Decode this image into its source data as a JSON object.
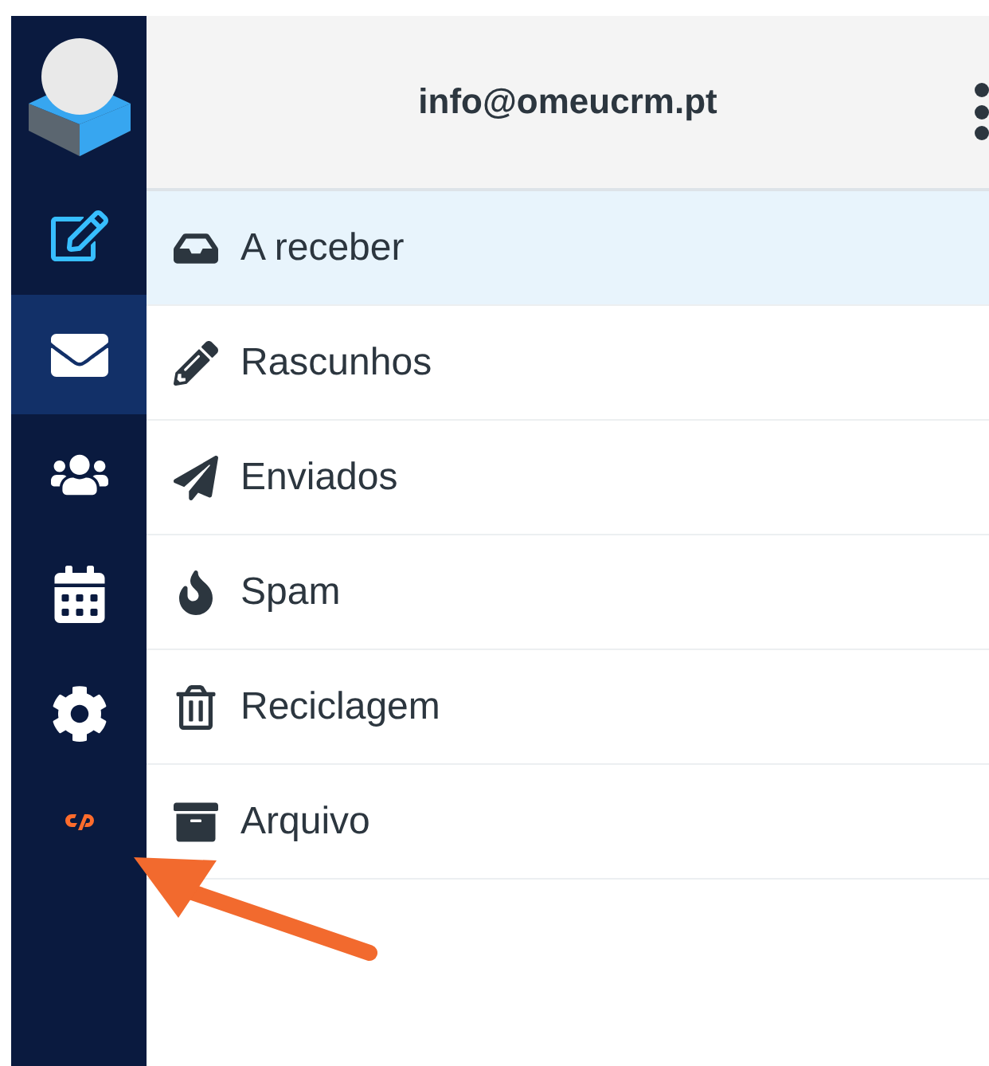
{
  "sidebar": {
    "items": [
      {
        "kind": "compose",
        "selected": false
      },
      {
        "kind": "mail",
        "selected": true
      },
      {
        "kind": "contacts",
        "selected": false
      },
      {
        "kind": "calendar",
        "selected": false
      },
      {
        "kind": "settings",
        "selected": false
      },
      {
        "kind": "cpanel",
        "selected": false
      }
    ]
  },
  "header": {
    "title": "info@omeucrm.pt"
  },
  "folders": [
    {
      "kind": "inbox",
      "label": "A receber",
      "selected": true
    },
    {
      "kind": "drafts",
      "label": "Rascunhos",
      "selected": false
    },
    {
      "kind": "sent",
      "label": "Enviados",
      "selected": false
    },
    {
      "kind": "spam",
      "label": "Spam",
      "selected": false
    },
    {
      "kind": "trash",
      "label": "Reciclagem",
      "selected": false
    },
    {
      "kind": "archive",
      "label": "Arquivo",
      "selected": false
    }
  ]
}
